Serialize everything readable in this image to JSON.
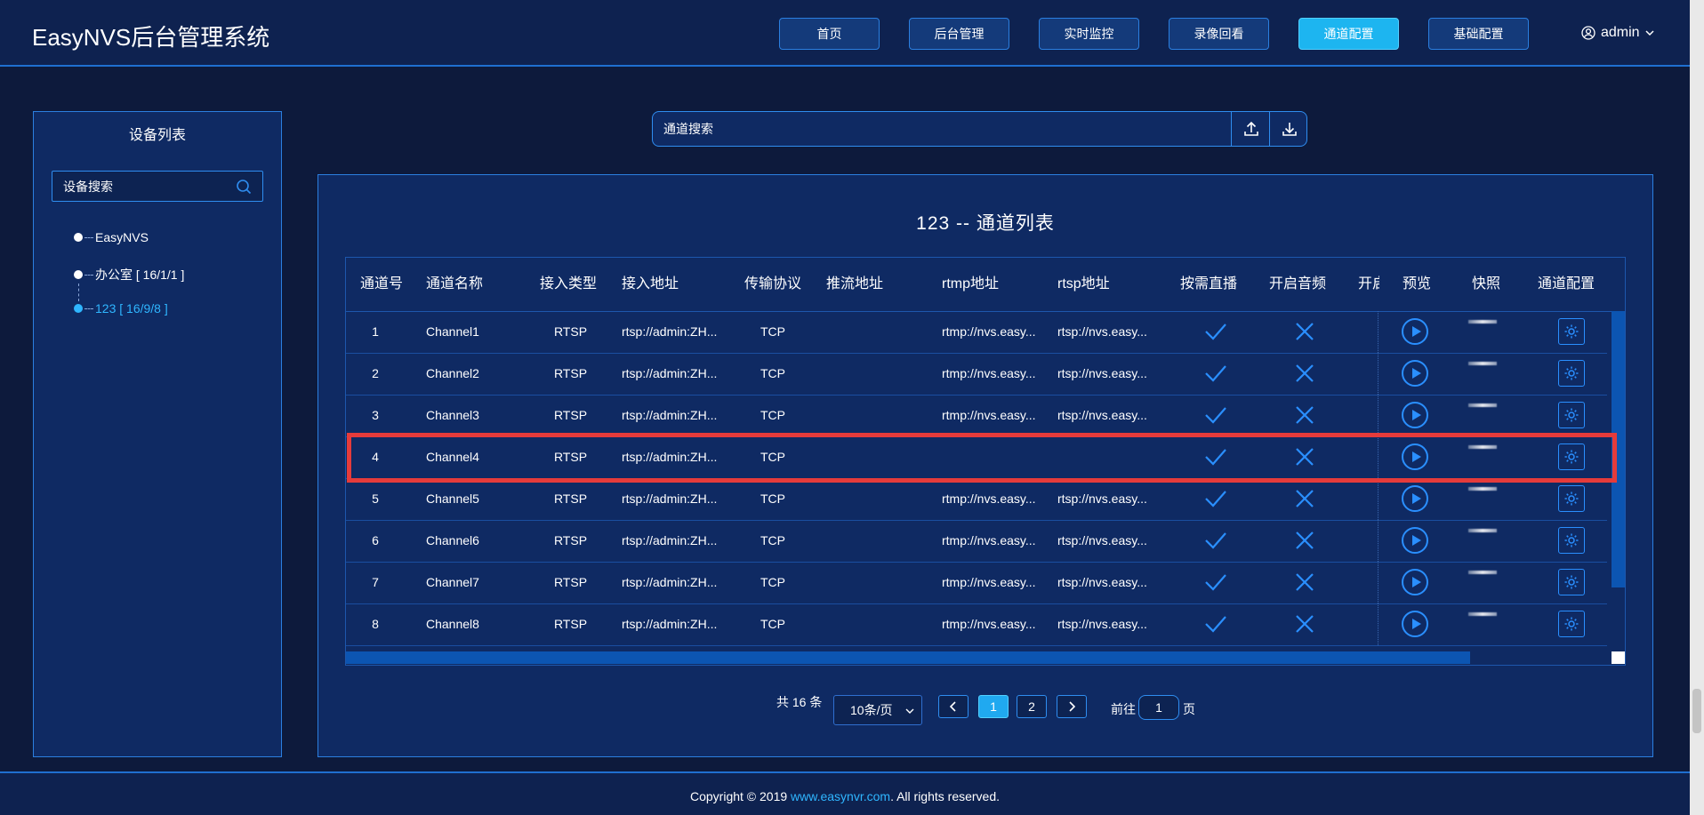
{
  "app": {
    "title": "EasyNVS后台管理系统",
    "user": "admin"
  },
  "nav": [
    "首页",
    "后台管理",
    "实时监控",
    "录像回看",
    "通道配置",
    "基础配置"
  ],
  "sidebar": {
    "title": "设备列表",
    "search_placeholder": "设备搜索",
    "tree": [
      "EasyNVS",
      "办公室 [ 16/1/1 ]",
      "123 [ 16/9/8 ]"
    ]
  },
  "channel_search": {
    "placeholder": "通道搜索"
  },
  "panel": {
    "title": "123 -- 通道列表"
  },
  "table": {
    "headers": [
      "通道号",
      "通道名称",
      "接入类型",
      "接入地址",
      "传输协议",
      "推流地址",
      "rtmp地址",
      "rtsp地址",
      "按需直播",
      "开启音频",
      "开启",
      "预览",
      "快照",
      "通道配置"
    ],
    "rows": [
      {
        "id": "1",
        "name": "Channel1",
        "type": "RTSP",
        "addr": "rtsp://admin:ZH...",
        "proto": "TCP",
        "push": "",
        "rtmp": "rtmp://nvs.easy...",
        "rtsp": "rtsp://nvs.easy..."
      },
      {
        "id": "2",
        "name": "Channel2",
        "type": "RTSP",
        "addr": "rtsp://admin:ZH...",
        "proto": "TCP",
        "push": "",
        "rtmp": "rtmp://nvs.easy...",
        "rtsp": "rtsp://nvs.easy..."
      },
      {
        "id": "3",
        "name": "Channel3",
        "type": "RTSP",
        "addr": "rtsp://admin:ZH...",
        "proto": "TCP",
        "push": "",
        "rtmp": "rtmp://nvs.easy...",
        "rtsp": "rtsp://nvs.easy..."
      },
      {
        "id": "4",
        "name": "Channel4",
        "type": "RTSP",
        "addr": "rtsp://admin:ZH...",
        "proto": "TCP",
        "push": "",
        "rtmp": "",
        "rtsp": ""
      },
      {
        "id": "5",
        "name": "Channel5",
        "type": "RTSP",
        "addr": "rtsp://admin:ZH...",
        "proto": "TCP",
        "push": "",
        "rtmp": "rtmp://nvs.easy...",
        "rtsp": "rtsp://nvs.easy..."
      },
      {
        "id": "6",
        "name": "Channel6",
        "type": "RTSP",
        "addr": "rtsp://admin:ZH...",
        "proto": "TCP",
        "push": "",
        "rtmp": "rtmp://nvs.easy...",
        "rtsp": "rtsp://nvs.easy..."
      },
      {
        "id": "7",
        "name": "Channel7",
        "type": "RTSP",
        "addr": "rtsp://admin:ZH...",
        "proto": "TCP",
        "push": "",
        "rtmp": "rtmp://nvs.easy...",
        "rtsp": "rtsp://nvs.easy..."
      },
      {
        "id": "8",
        "name": "Channel8",
        "type": "RTSP",
        "addr": "rtsp://admin:ZH...",
        "proto": "TCP",
        "push": "",
        "rtmp": "rtmp://nvs.easy...",
        "rtsp": "rtsp://nvs.easy..."
      }
    ]
  },
  "pagination": {
    "total": "共 16 条",
    "page_size": "10条/页",
    "pages": [
      "1",
      "2"
    ],
    "goto_label": "前往",
    "goto_value": "1",
    "goto_suffix": "页"
  },
  "footer": {
    "prefix": "Copyright © 2019 ",
    "link": "www.easynvr.com",
    "suffix": ". All rights reserved."
  },
  "colors": {
    "accent": "#2fb6ff",
    "active_nav": "#1db5f0",
    "highlight": "#e53b3b",
    "panel": "#0f2a63"
  }
}
